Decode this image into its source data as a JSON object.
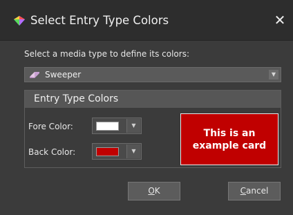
{
  "dialog": {
    "title": "Select Entry Type Colors",
    "close_label": "✕"
  },
  "media_type": {
    "prompt": "Select a media type to define its colors:",
    "selected": "Sweeper"
  },
  "entry_type_colors": {
    "heading": "Entry Type Colors",
    "fore_label": "Fore Color:",
    "back_label": "Back Color:",
    "fore_color": "#ffffff",
    "back_color": "#c00000"
  },
  "example_card": {
    "text": "This is an example card",
    "background": "#c00000",
    "foreground": "#ffffff"
  },
  "buttons": {
    "ok_accel": "O",
    "ok_rest": "K",
    "cancel_accel": "C",
    "cancel_rest": "ancel"
  },
  "icons": {
    "title": "color-palette-icon",
    "media": "eraser-icon",
    "dropdown": "chevron-down-icon"
  }
}
